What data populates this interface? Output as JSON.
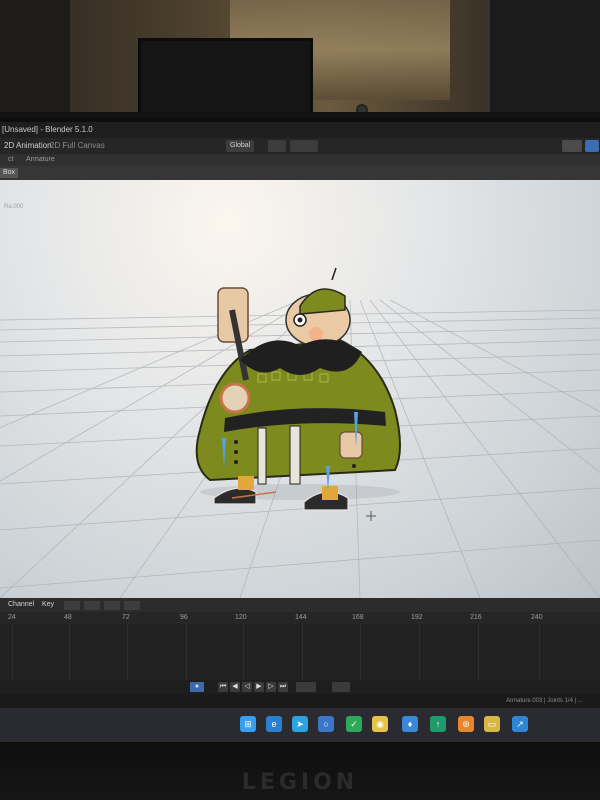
{
  "window": {
    "title": "[Unsaved] - Blender 5.1.0"
  },
  "workspace": {
    "active_tab": "2D Animation",
    "second_tab": "2D Full Canvas"
  },
  "header": {
    "item1": "ct",
    "item2": "Armature"
  },
  "toolbar": {
    "orientation_label": "Global"
  },
  "viewport": {
    "mode_label": "Box",
    "overlay_text": "Ra.000"
  },
  "timeline": {
    "channel_label": "Channel",
    "key_label": "Key",
    "ruler": [
      "24",
      "48",
      "72",
      "96",
      "120",
      "144",
      "168",
      "192",
      "216",
      "240"
    ]
  },
  "status": {
    "text": "Armature.003 | Joints 1/4 | ..."
  },
  "brand": {
    "text": "LEGION"
  },
  "colors": {
    "blender_blue": "#3a6bb0",
    "robe_green": "#8a9a2a",
    "taskbar_bg": "#2a2b30"
  },
  "icons": {
    "taskbar": [
      "windows-start-icon",
      "edge-icon",
      "telegram-icon",
      "cortana-icon",
      "checkmark-icon",
      "chrome-icon",
      "water-drop-icon",
      "green-app-icon",
      "blender-icon",
      "folder-icon",
      "blue-app-icon"
    ]
  }
}
